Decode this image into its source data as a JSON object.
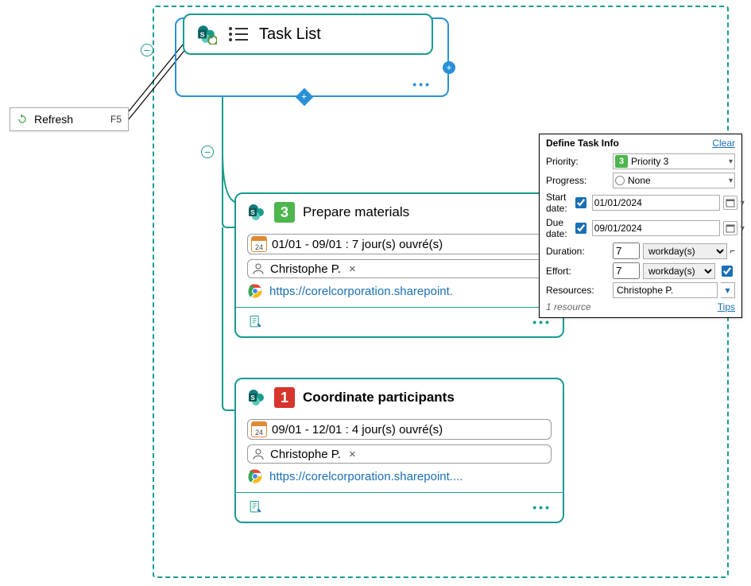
{
  "contextMenu": {
    "refresh": "Refresh",
    "refreshKey": "F5"
  },
  "root": {
    "title": "Task List"
  },
  "tasks": [
    {
      "priority": "3",
      "title": "Prepare materials",
      "dateRange": "01/01 - 09/01 : 7 jour(s) ouvré(s)",
      "cal": "24",
      "assignee": "Christophe P.",
      "link": "https://corelcorporation.sharepoint."
    },
    {
      "priority": "1",
      "title": "Coordinate participants",
      "dateRange": "09/01 - 12/01 : 4 jour(s) ouvré(s)",
      "cal": "24",
      "assignee": "Christophe P.",
      "link": "https://corelcorporation.sharepoint...."
    }
  ],
  "panel": {
    "title": "Define Task Info",
    "clear": "Clear",
    "labels": {
      "priority": "Priority:",
      "progress": "Progress:",
      "start": "Start date:",
      "due": "Due date:",
      "duration": "Duration:",
      "effort": "Effort:",
      "resources": "Resources:"
    },
    "values": {
      "priority": "Priority 3",
      "priorityNum": "3",
      "progress": "None",
      "start": "01/01/2024",
      "due": "09/01/2024",
      "duration": "7",
      "durationUnit": "workday(s)",
      "effort": "7",
      "effortUnit": "workday(s)",
      "resource": "Christophe P."
    },
    "resourceCount": "1 resource",
    "tips": "Tips"
  },
  "glyphs": {
    "minus": "−",
    "plus": "+",
    "ellipsis": "•••",
    "x": "×",
    "chevron": "▾"
  }
}
